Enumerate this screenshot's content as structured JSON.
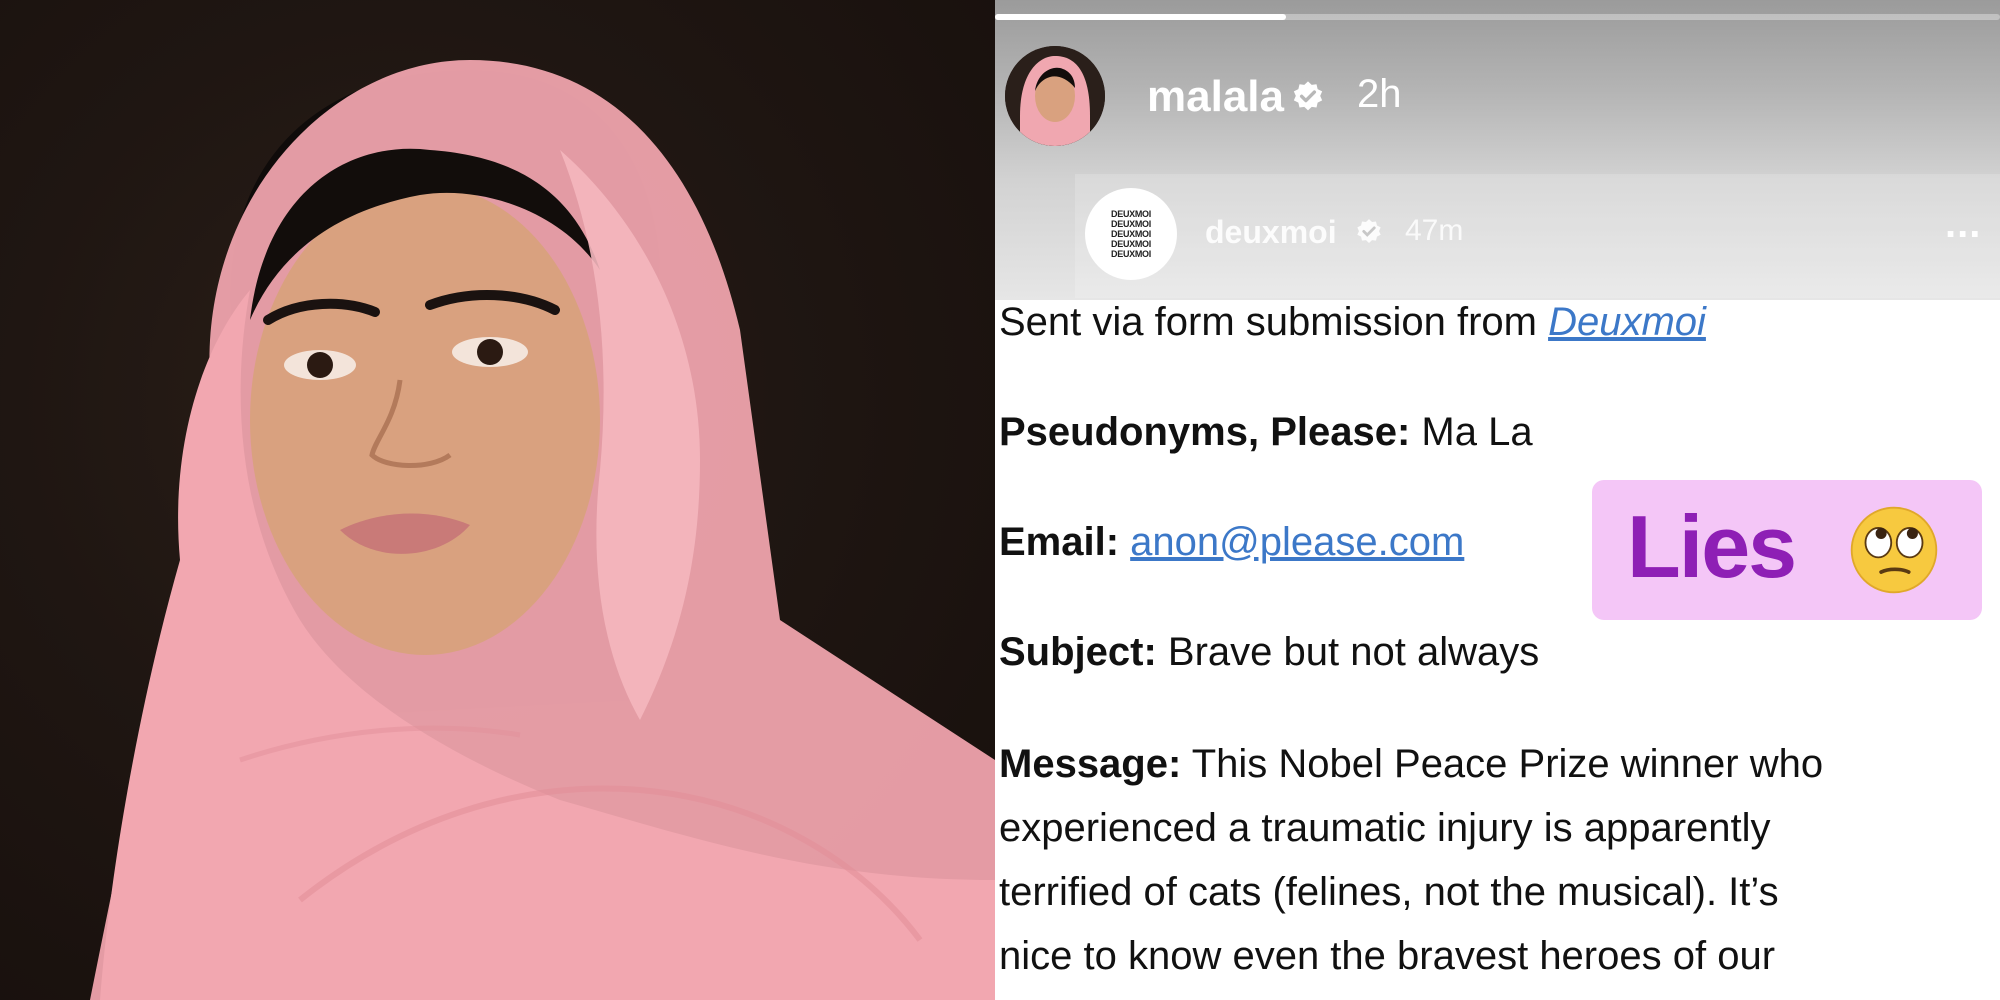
{
  "story": {
    "user": {
      "name": "malala",
      "time": "2h"
    },
    "progress": 0.29,
    "embedded_post": {
      "logo_lines": [
        "DEUXMOI",
        "DEUXMOI",
        "DEUXMOI",
        "DEUXMOI",
        "DEUXMOI"
      ],
      "name": "deuxmoi",
      "time": "47m",
      "more": "..."
    },
    "form": {
      "sent_via_prefix": "Sent via form submission from ",
      "sent_via_link": "Deuxmoi",
      "pseudonyms_label": "Pseudonyms, Please:",
      "pseudonyms_value": " Ma La",
      "email_label": "Email:",
      "email_value": "anon@please.com",
      "subject_label": "Subject:",
      "subject_value": " Brave but not always",
      "message_label": "Message:",
      "message_lines": [
        " This Nobel Peace Prize winner who",
        "experienced a traumatic injury is apparently",
        "terrified of cats (felines, not the musical). It’s",
        "nice to know even the bravest heroes of our"
      ]
    },
    "sticker": {
      "text": "Lies",
      "emoji": "face-with-rolling-eyes-icon"
    }
  },
  "colors": {
    "link": "#3c78c8",
    "sticker_bg": "#f4c6f7",
    "sticker_text": "#8e1fb5",
    "scarf": "#f2a7b0"
  }
}
